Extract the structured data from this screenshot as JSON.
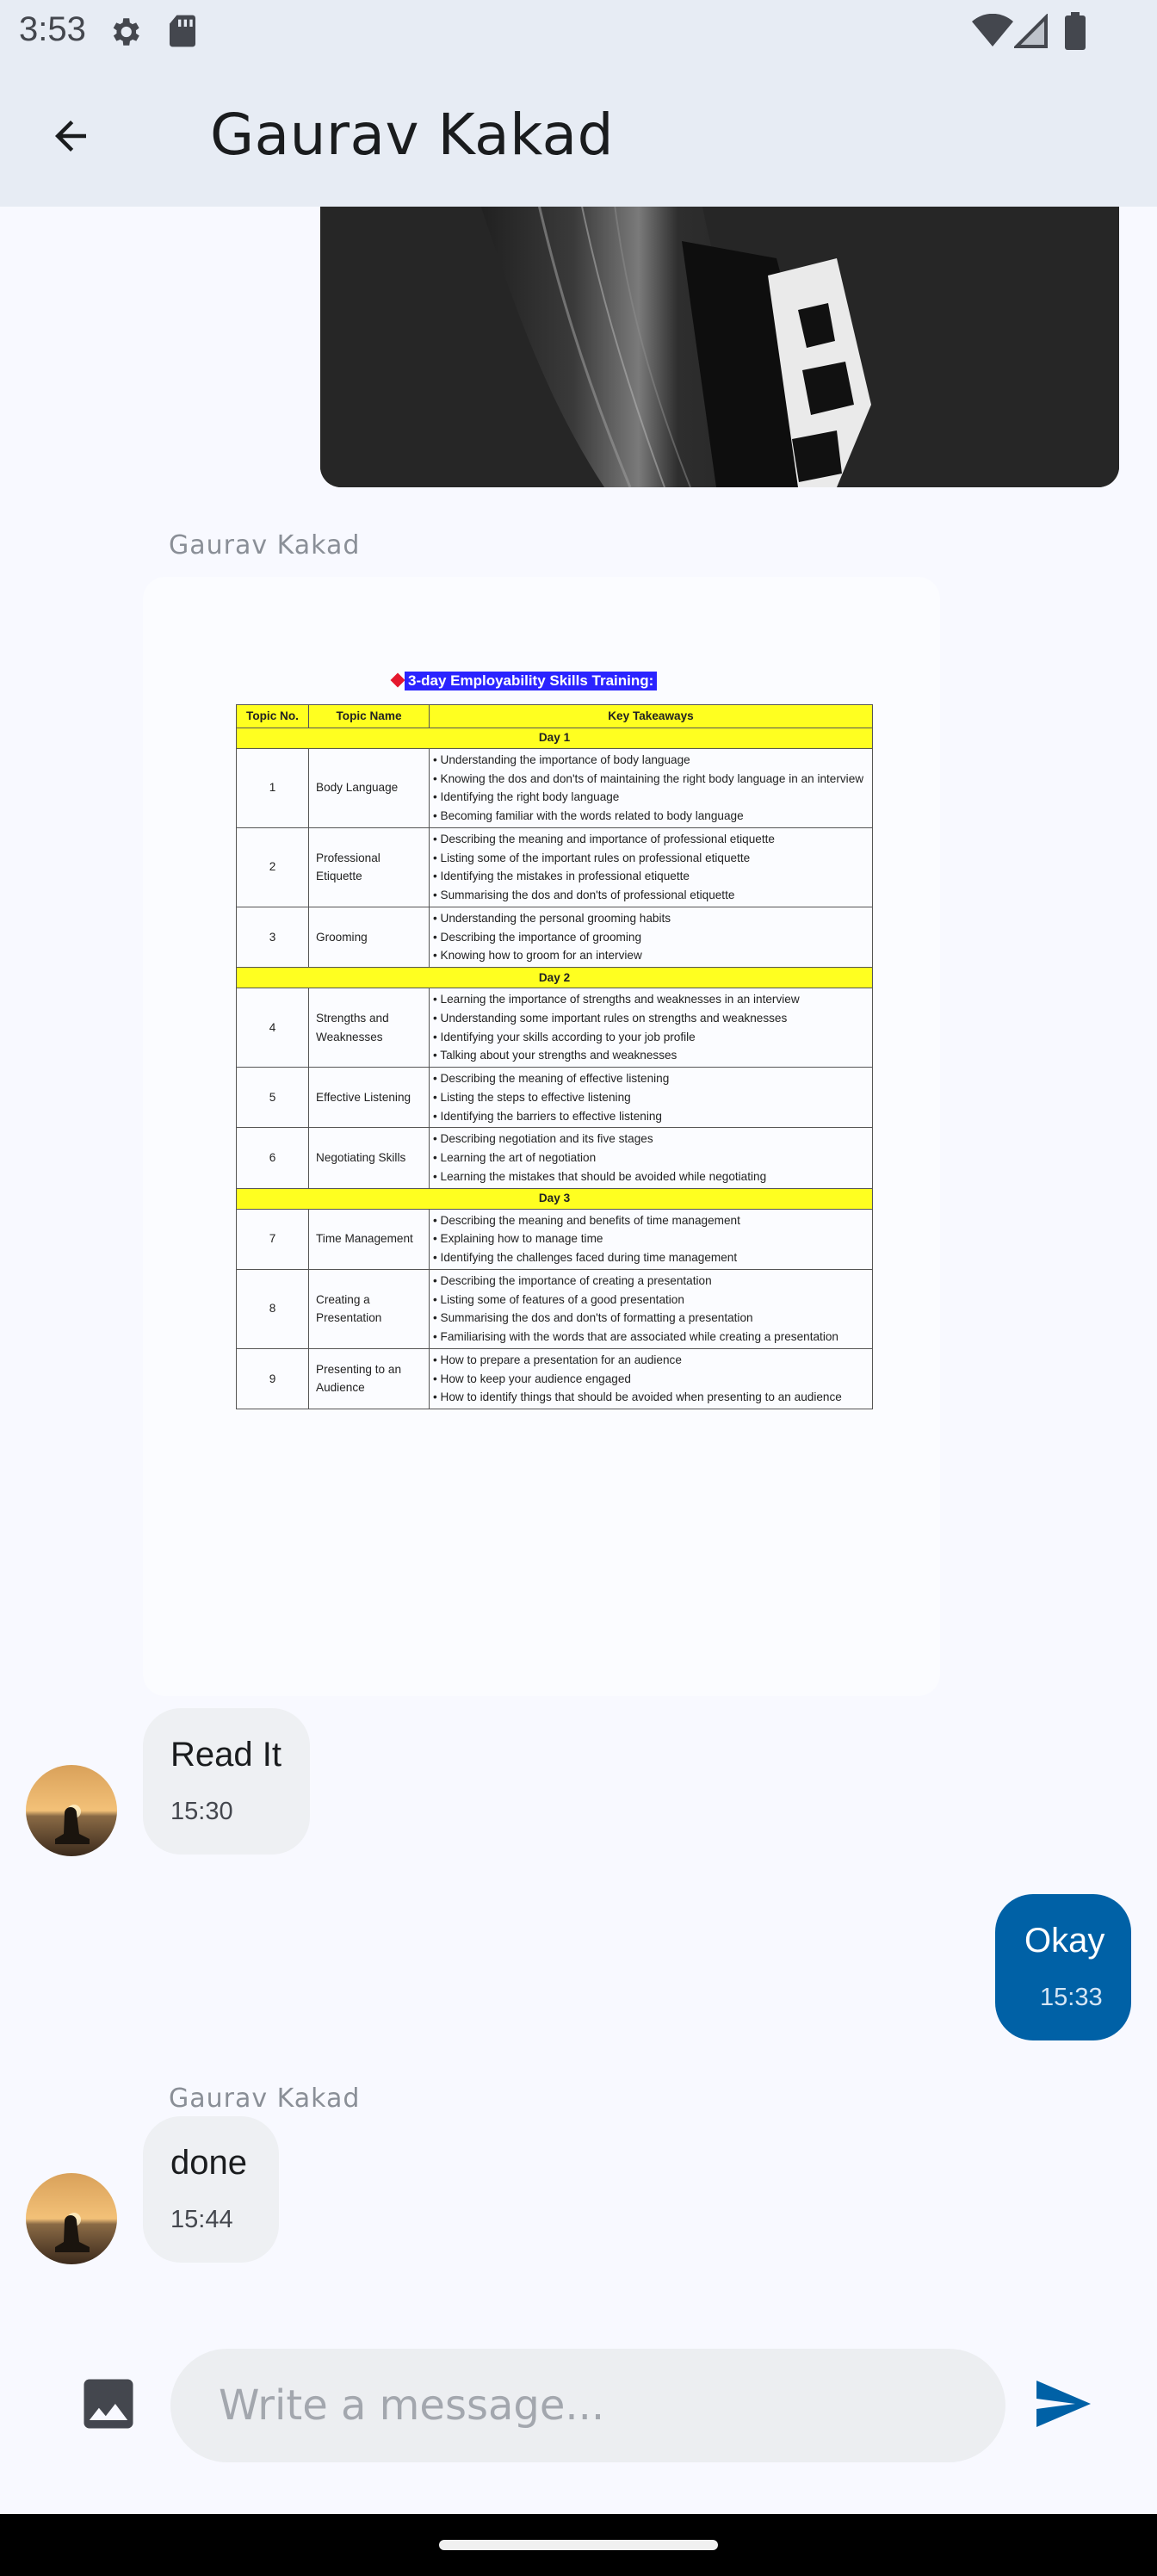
{
  "status_bar": {
    "time": "3:53",
    "icons": [
      "gear-icon",
      "sd-card-icon",
      "wifi-icon",
      "signal-icon",
      "battery-icon"
    ]
  },
  "app_bar": {
    "title": "Gaurav Kakad",
    "back_icon": "arrow-back-icon"
  },
  "messages": [
    {
      "type": "image",
      "direction": "outgoing"
    },
    {
      "type": "document",
      "direction": "incoming",
      "sender": "Gaurav Kakad",
      "document": {
        "heading": "3-day Employability Skills Training:",
        "columns": [
          "Topic No.",
          "Topic Name",
          "Key Takeaways"
        ],
        "days": [
          {
            "label": "Day 1",
            "rows": [
              {
                "no": "1",
                "name": "Body Language",
                "takeaways": [
                  "• Understanding the importance of body language",
                  "• Knowing the dos and don'ts of maintaining the right body language in an interview",
                  "• Identifying the right body language",
                  "• Becoming familiar with the words related to body language"
                ]
              },
              {
                "no": "2",
                "name": "Professional Etiquette",
                "takeaways": [
                  "• Describing the meaning and importance of professional etiquette",
                  "• Listing some of the important rules on professional etiquette",
                  "• Identifying the mistakes in professional etiquette",
                  "• Summarising the dos and don'ts of professional etiquette"
                ]
              },
              {
                "no": "3",
                "name": "Grooming",
                "takeaways": [
                  "• Understanding the personal grooming habits",
                  "• Describing the importance of grooming",
                  "• Knowing how to groom for an interview"
                ]
              }
            ]
          },
          {
            "label": "Day 2",
            "rows": [
              {
                "no": "4",
                "name": "Strengths and Weaknesses",
                "takeaways": [
                  "• Learning the importance of strengths and weaknesses in an interview",
                  "• Understanding some important rules on strengths and weaknesses",
                  "• Identifying your skills according to your job profile",
                  "• Talking about your strengths and weaknesses"
                ]
              },
              {
                "no": "5",
                "name": "Effective Listening",
                "takeaways": [
                  "• Describing the meaning of effective listening",
                  "• Listing the steps to effective listening",
                  "• Identifying the barriers to effective listening"
                ]
              },
              {
                "no": "6",
                "name": "Negotiating Skills",
                "takeaways": [
                  "• Describing negotiation and its five stages",
                  "• Learning the art of negotiation",
                  "• Learning the mistakes that should be avoided while negotiating"
                ]
              }
            ]
          },
          {
            "label": "Day 3",
            "rows": [
              {
                "no": "7",
                "name": "Time Management",
                "takeaways": [
                  "• Describing the meaning and benefits of time management",
                  "• Explaining how to manage time",
                  "• Identifying the challenges faced during time management"
                ]
              },
              {
                "no": "8",
                "name": "Creating a Presentation",
                "takeaways": [
                  "• Describing the importance of creating a presentation",
                  "• Listing some of features of a good presentation",
                  "• Summarising the dos and don'ts of formatting a presentation",
                  "• Familiarising with the words that are associated while creating a presentation"
                ]
              },
              {
                "no": "9",
                "name": "Presenting to an Audience",
                "takeaways": [
                  "• How to prepare a presentation for an audience",
                  "• How to keep your audience engaged",
                  "• How to identify things that should be avoided when presenting to an audience"
                ]
              }
            ]
          }
        ]
      }
    },
    {
      "type": "text",
      "direction": "incoming",
      "text": "Read It",
      "time": "15:30"
    },
    {
      "type": "text",
      "direction": "outgoing",
      "text": "Okay",
      "time": "15:33"
    },
    {
      "type": "text",
      "direction": "incoming",
      "sender": "Gaurav Kakad",
      "text": "done",
      "time": "15:44"
    }
  ],
  "composer": {
    "placeholder": "Write a message...",
    "image_icon": "image-icon",
    "send_icon": "send-icon"
  },
  "colors": {
    "app_bar_bg": "#e7ecf4",
    "outgoing_bubble": "#0061a6",
    "incoming_bubble": "#eef0f3",
    "send_icon": "#0061a6"
  }
}
